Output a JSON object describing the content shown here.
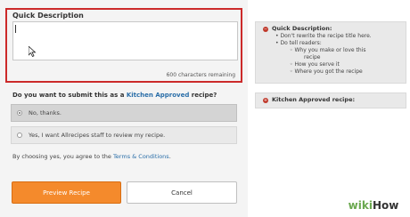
{
  "form": {
    "quick_description_title": "Quick Description",
    "char_remaining": "600 characters remaining",
    "question_prefix": "Do you want to submit this as a ",
    "question_accent": "Kitchen Approved",
    "question_suffix": " recipe?",
    "option_no": "No, thanks.",
    "option_yes": "Yes, I want Allrecipes staff to review my recipe.",
    "terms_prefix": "By choosing yes, you agree to the ",
    "terms_link": "Terms & Conditions",
    "terms_suffix": ".",
    "preview_button": "Preview Recipe",
    "cancel_button": "Cancel"
  },
  "sidebar": {
    "tips_title": "Quick Description:",
    "tip1": "Don't rewrite the recipe title here.",
    "tip2": "Do tell readers:",
    "tip2a": "Why you make or love this",
    "tip2a2": "recipe",
    "tip2b": "How you serve it",
    "tip2c": "Where you got the recipe",
    "kitchen_title": "Kitchen Approved recipe:"
  },
  "watermark": {
    "wiki": "wiki",
    "how": "How"
  },
  "colors": {
    "accent": "#2a6ea8",
    "preview_button": "#f48a2c",
    "highlight": "#cc2a2a"
  }
}
